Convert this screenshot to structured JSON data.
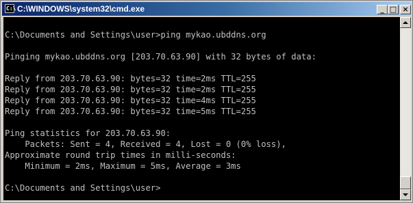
{
  "window": {
    "title": "C:\\WINDOWS\\system32\\cmd.exe",
    "icon_label": "C:\\",
    "buttons": {
      "minimize": "_",
      "maximize": "□",
      "close": "×"
    }
  },
  "console": {
    "lines": [
      "",
      "C:\\Documents and Settings\\user>ping mykao.ubddns.org",
      "",
      "Pinging mykao.ubddns.org [203.70.63.90] with 32 bytes of data:",
      "",
      "Reply from 203.70.63.90: bytes=32 time=2ms TTL=255",
      "Reply from 203.70.63.90: bytes=32 time=2ms TTL=255",
      "Reply from 203.70.63.90: bytes=32 time=4ms TTL=255",
      "Reply from 203.70.63.90: bytes=32 time=5ms TTL=255",
      "",
      "Ping statistics for 203.70.63.90:",
      "    Packets: Sent = 4, Received = 4, Lost = 0 (0% loss),",
      "Approximate round trip times in milli-seconds:",
      "    Minimum = 2ms, Maximum = 5ms, Average = 3ms",
      "",
      "C:\\Documents and Settings\\user>"
    ]
  },
  "colors": {
    "title_start": "#0a246a",
    "title_end": "#a6caf0",
    "console_bg": "#000000",
    "console_fg": "#c0c0c0"
  }
}
